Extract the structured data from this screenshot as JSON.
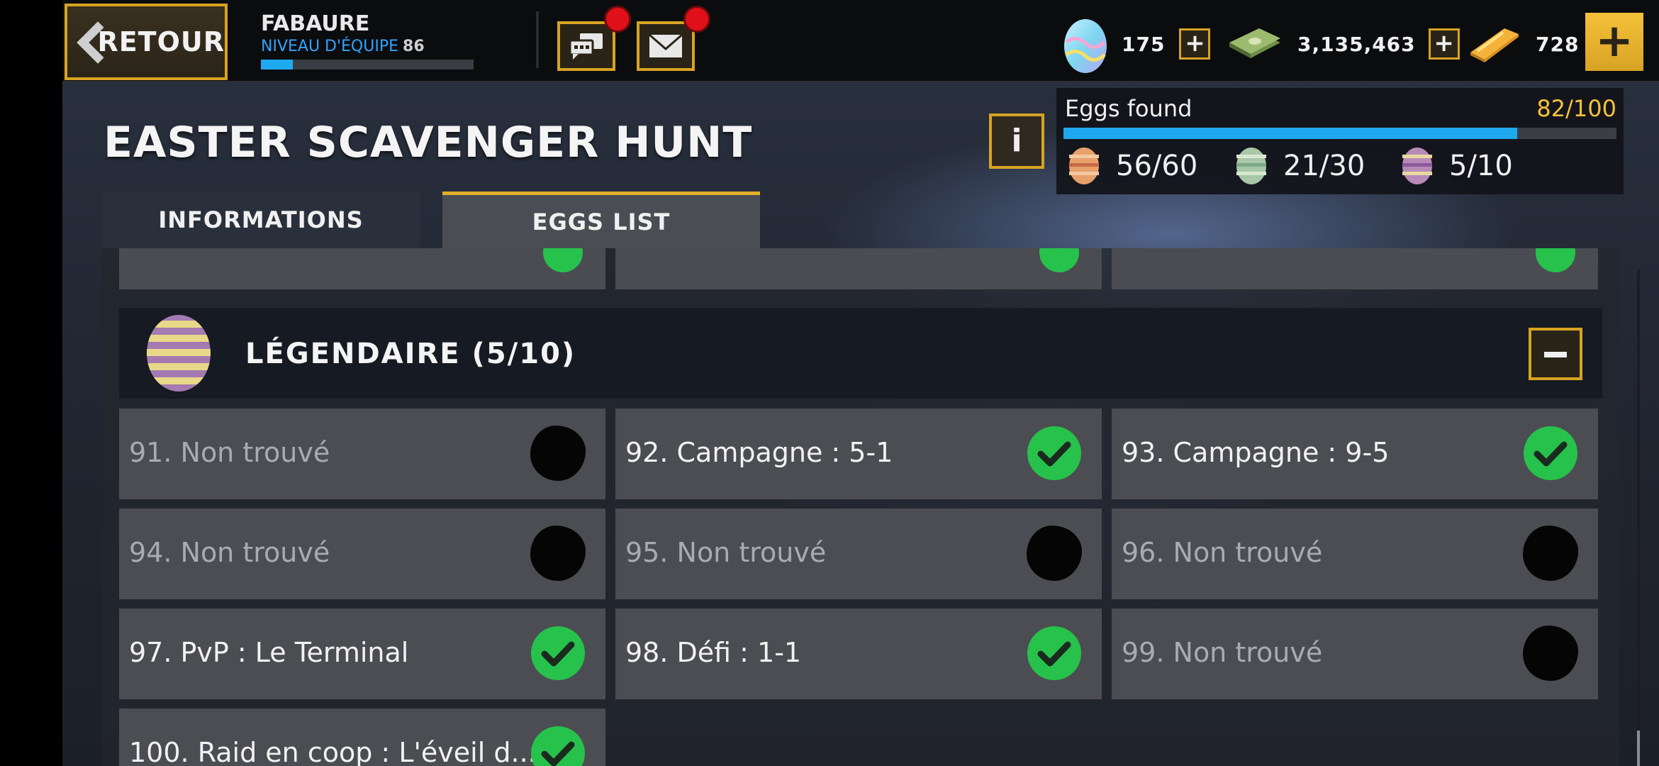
{
  "topbar": {
    "back_label": "RETOUR",
    "player_name": "FABAURE",
    "level_label": "NIVEAU D'ÉQUIPE",
    "level_value": "86",
    "xp_progress": 0.15,
    "resources": {
      "eggs": "175",
      "cash": "3,135,463",
      "gold": "728"
    }
  },
  "page": {
    "title": "EASTER SCAVENGER HUNT",
    "info_button": "i"
  },
  "eggs_found": {
    "label": "Eggs found",
    "count": "82/100",
    "progress": 0.82,
    "by_rarity": [
      {
        "name": "common-egg",
        "value": "56/60"
      },
      {
        "name": "rare-egg",
        "value": "21/30"
      },
      {
        "name": "legendary-egg",
        "value": "5/10"
      }
    ]
  },
  "tabs": [
    {
      "label": "INFORMATIONS",
      "active": false
    },
    {
      "label": "EGGS LIST",
      "active": true
    }
  ],
  "section": {
    "title": "LÉGENDAIRE (5/10)"
  },
  "eggs": [
    {
      "label": "91. Non trouvé",
      "found": false
    },
    {
      "label": "92. Campagne : 5-1",
      "found": true
    },
    {
      "label": "93. Campagne : 9-5",
      "found": true
    },
    {
      "label": "94. Non trouvé",
      "found": false
    },
    {
      "label": "95. Non trouvé",
      "found": false
    },
    {
      "label": "96. Non trouvé",
      "found": false
    },
    {
      "label": "97. PvP : Le Terminal",
      "found": true
    },
    {
      "label": "98. Défi : 1-1",
      "found": true
    },
    {
      "label": "99. Non trouvé",
      "found": false
    },
    {
      "label": "100. Raid en coop : L'éveil d...",
      "found": true
    }
  ],
  "colors": {
    "accent_gold": "#d8a323",
    "progress_blue": "#1fa8ee",
    "found_green": "#27c24c"
  }
}
